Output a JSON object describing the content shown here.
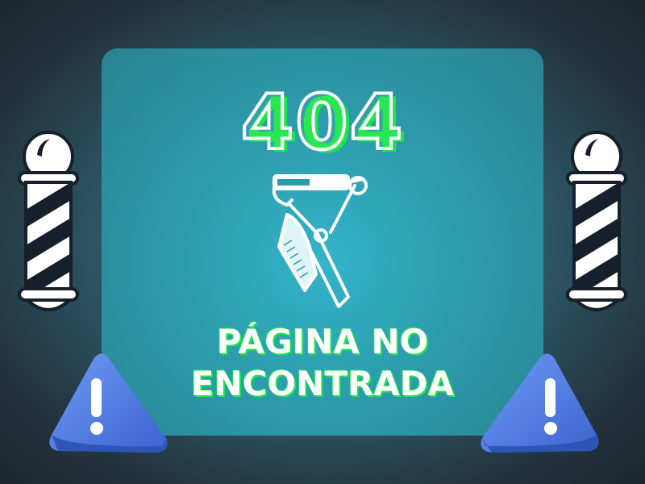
{
  "error": {
    "code": "404",
    "message_line1": "PÁGINA NO",
    "message_line2": "ENCONTRADA"
  },
  "icons": {
    "scissors_comb": "scissors-comb-icon",
    "barber_pole": "barber-pole-icon",
    "warning": "warning-triangle-icon"
  },
  "colors": {
    "accent_green": "#1ee64a",
    "panel_teal": "#2c9cad",
    "warning_blue": "#4f7fe6",
    "background_dark": "#22323c"
  }
}
